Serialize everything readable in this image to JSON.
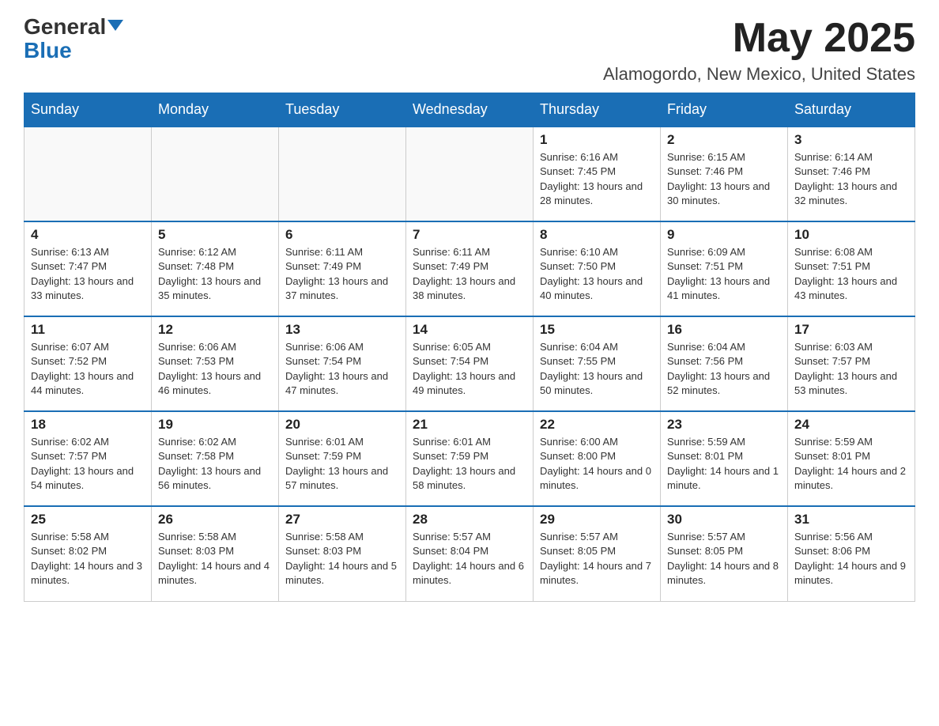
{
  "header": {
    "logo_general": "General",
    "logo_blue": "Blue",
    "month": "May 2025",
    "location": "Alamogordo, New Mexico, United States"
  },
  "days_of_week": [
    "Sunday",
    "Monday",
    "Tuesday",
    "Wednesday",
    "Thursday",
    "Friday",
    "Saturday"
  ],
  "weeks": [
    [
      {
        "day": "",
        "info": ""
      },
      {
        "day": "",
        "info": ""
      },
      {
        "day": "",
        "info": ""
      },
      {
        "day": "",
        "info": ""
      },
      {
        "day": "1",
        "info": "Sunrise: 6:16 AM\nSunset: 7:45 PM\nDaylight: 13 hours and 28 minutes."
      },
      {
        "day": "2",
        "info": "Sunrise: 6:15 AM\nSunset: 7:46 PM\nDaylight: 13 hours and 30 minutes."
      },
      {
        "day": "3",
        "info": "Sunrise: 6:14 AM\nSunset: 7:46 PM\nDaylight: 13 hours and 32 minutes."
      }
    ],
    [
      {
        "day": "4",
        "info": "Sunrise: 6:13 AM\nSunset: 7:47 PM\nDaylight: 13 hours and 33 minutes."
      },
      {
        "day": "5",
        "info": "Sunrise: 6:12 AM\nSunset: 7:48 PM\nDaylight: 13 hours and 35 minutes."
      },
      {
        "day": "6",
        "info": "Sunrise: 6:11 AM\nSunset: 7:49 PM\nDaylight: 13 hours and 37 minutes."
      },
      {
        "day": "7",
        "info": "Sunrise: 6:11 AM\nSunset: 7:49 PM\nDaylight: 13 hours and 38 minutes."
      },
      {
        "day": "8",
        "info": "Sunrise: 6:10 AM\nSunset: 7:50 PM\nDaylight: 13 hours and 40 minutes."
      },
      {
        "day": "9",
        "info": "Sunrise: 6:09 AM\nSunset: 7:51 PM\nDaylight: 13 hours and 41 minutes."
      },
      {
        "day": "10",
        "info": "Sunrise: 6:08 AM\nSunset: 7:51 PM\nDaylight: 13 hours and 43 minutes."
      }
    ],
    [
      {
        "day": "11",
        "info": "Sunrise: 6:07 AM\nSunset: 7:52 PM\nDaylight: 13 hours and 44 minutes."
      },
      {
        "day": "12",
        "info": "Sunrise: 6:06 AM\nSunset: 7:53 PM\nDaylight: 13 hours and 46 minutes."
      },
      {
        "day": "13",
        "info": "Sunrise: 6:06 AM\nSunset: 7:54 PM\nDaylight: 13 hours and 47 minutes."
      },
      {
        "day": "14",
        "info": "Sunrise: 6:05 AM\nSunset: 7:54 PM\nDaylight: 13 hours and 49 minutes."
      },
      {
        "day": "15",
        "info": "Sunrise: 6:04 AM\nSunset: 7:55 PM\nDaylight: 13 hours and 50 minutes."
      },
      {
        "day": "16",
        "info": "Sunrise: 6:04 AM\nSunset: 7:56 PM\nDaylight: 13 hours and 52 minutes."
      },
      {
        "day": "17",
        "info": "Sunrise: 6:03 AM\nSunset: 7:57 PM\nDaylight: 13 hours and 53 minutes."
      }
    ],
    [
      {
        "day": "18",
        "info": "Sunrise: 6:02 AM\nSunset: 7:57 PM\nDaylight: 13 hours and 54 minutes."
      },
      {
        "day": "19",
        "info": "Sunrise: 6:02 AM\nSunset: 7:58 PM\nDaylight: 13 hours and 56 minutes."
      },
      {
        "day": "20",
        "info": "Sunrise: 6:01 AM\nSunset: 7:59 PM\nDaylight: 13 hours and 57 minutes."
      },
      {
        "day": "21",
        "info": "Sunrise: 6:01 AM\nSunset: 7:59 PM\nDaylight: 13 hours and 58 minutes."
      },
      {
        "day": "22",
        "info": "Sunrise: 6:00 AM\nSunset: 8:00 PM\nDaylight: 14 hours and 0 minutes."
      },
      {
        "day": "23",
        "info": "Sunrise: 5:59 AM\nSunset: 8:01 PM\nDaylight: 14 hours and 1 minute."
      },
      {
        "day": "24",
        "info": "Sunrise: 5:59 AM\nSunset: 8:01 PM\nDaylight: 14 hours and 2 minutes."
      }
    ],
    [
      {
        "day": "25",
        "info": "Sunrise: 5:58 AM\nSunset: 8:02 PM\nDaylight: 14 hours and 3 minutes."
      },
      {
        "day": "26",
        "info": "Sunrise: 5:58 AM\nSunset: 8:03 PM\nDaylight: 14 hours and 4 minutes."
      },
      {
        "day": "27",
        "info": "Sunrise: 5:58 AM\nSunset: 8:03 PM\nDaylight: 14 hours and 5 minutes."
      },
      {
        "day": "28",
        "info": "Sunrise: 5:57 AM\nSunset: 8:04 PM\nDaylight: 14 hours and 6 minutes."
      },
      {
        "day": "29",
        "info": "Sunrise: 5:57 AM\nSunset: 8:05 PM\nDaylight: 14 hours and 7 minutes."
      },
      {
        "day": "30",
        "info": "Sunrise: 5:57 AM\nSunset: 8:05 PM\nDaylight: 14 hours and 8 minutes."
      },
      {
        "day": "31",
        "info": "Sunrise: 5:56 AM\nSunset: 8:06 PM\nDaylight: 14 hours and 9 minutes."
      }
    ]
  ]
}
